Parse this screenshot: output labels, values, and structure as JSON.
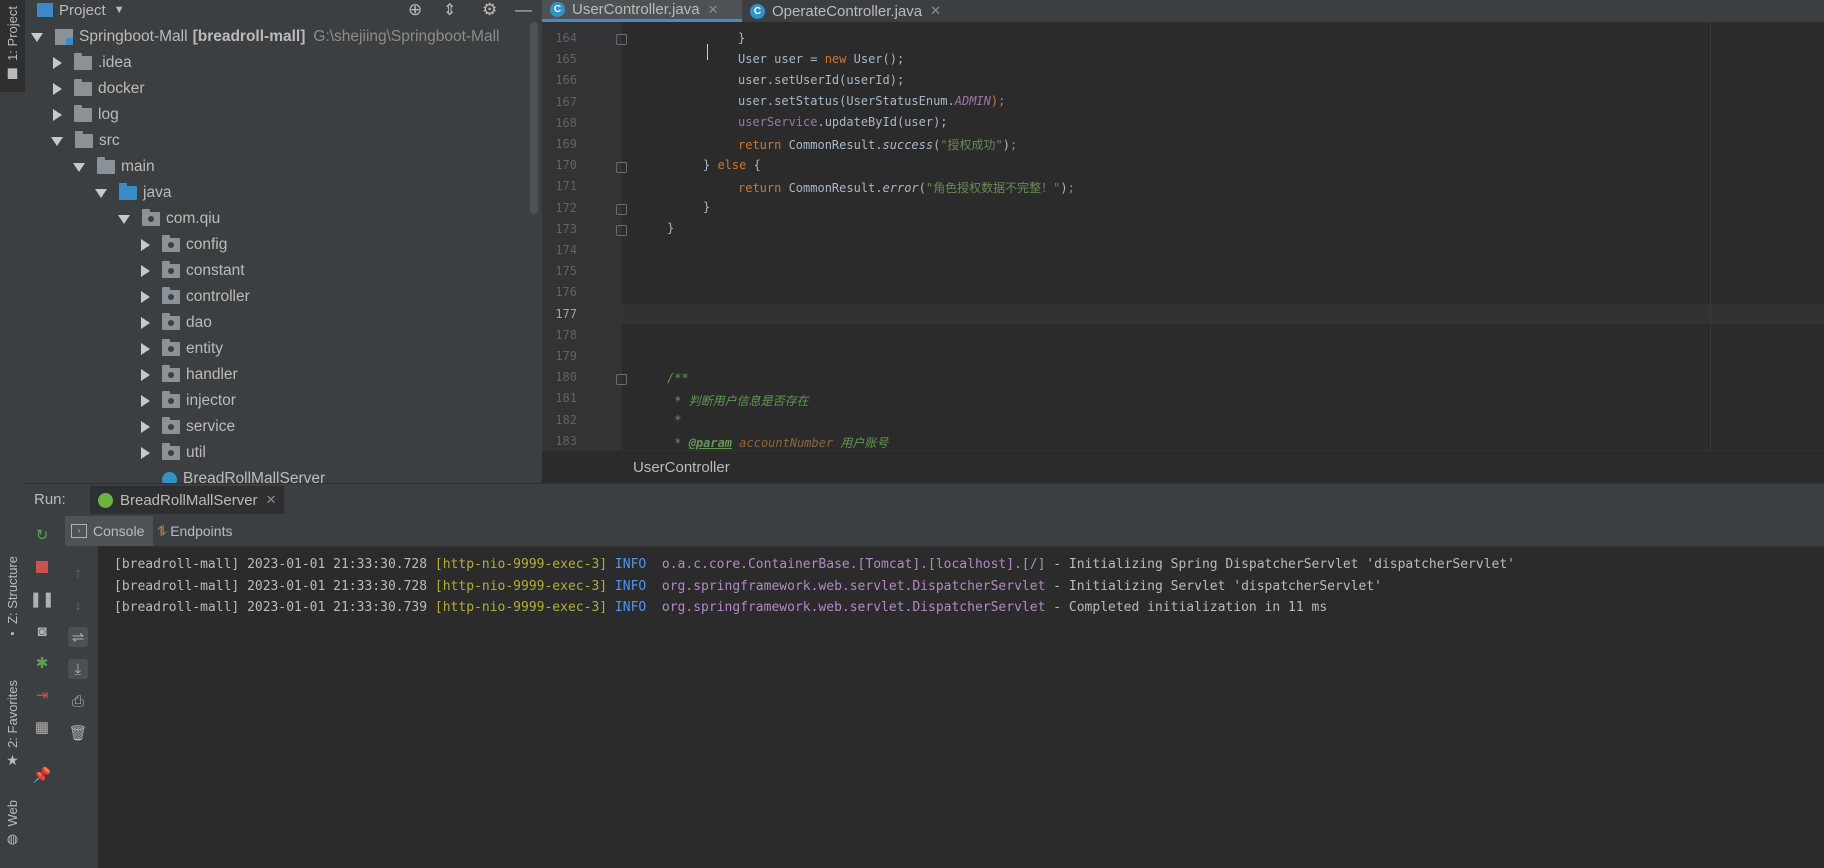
{
  "sidebar_left": {
    "project_tab": "1: Project",
    "structure_tab": "Z: Structure",
    "favorites_tab": "2: Favorites",
    "web_tab": "Web"
  },
  "project_panel": {
    "title": "Project",
    "tree": [
      {
        "label": "Springboot-Mall",
        "bold_part": "[breadroll-mall]",
        "path": "G:\\shejiing\\Springboot-Mall",
        "state": "expanded",
        "kind": "module"
      },
      {
        "label": ".idea",
        "state": "collapsed",
        "kind": "folder"
      },
      {
        "label": "docker",
        "state": "collapsed",
        "kind": "folder"
      },
      {
        "label": "log",
        "state": "collapsed",
        "kind": "folder"
      },
      {
        "label": "src",
        "state": "expanded",
        "kind": "folder"
      },
      {
        "label": "main",
        "state": "expanded",
        "kind": "folder"
      },
      {
        "label": "java",
        "state": "expanded",
        "kind": "source-folder"
      },
      {
        "label": "com.qiu",
        "state": "expanded",
        "kind": "package"
      },
      {
        "label": "config",
        "state": "collapsed",
        "kind": "package"
      },
      {
        "label": "constant",
        "state": "collapsed",
        "kind": "package"
      },
      {
        "label": "controller",
        "state": "collapsed",
        "kind": "package"
      },
      {
        "label": "dao",
        "state": "collapsed",
        "kind": "package"
      },
      {
        "label": "entity",
        "state": "collapsed",
        "kind": "package"
      },
      {
        "label": "handler",
        "state": "collapsed",
        "kind": "package"
      },
      {
        "label": "injector",
        "state": "collapsed",
        "kind": "package"
      },
      {
        "label": "service",
        "state": "collapsed",
        "kind": "package"
      },
      {
        "label": "util",
        "state": "collapsed",
        "kind": "package"
      },
      {
        "label": "BreadRollMallServer",
        "state": "none",
        "kind": "class"
      }
    ]
  },
  "editor": {
    "tabs": [
      {
        "label": "UserController.java",
        "active": true
      },
      {
        "label": "OperateController.java",
        "active": false
      }
    ],
    "line_numbers": [
      "164",
      "165",
      "166",
      "167",
      "168",
      "169",
      "170",
      "171",
      "172",
      "173",
      "174",
      "175",
      "176",
      "177",
      "178",
      "179",
      "180",
      "181",
      "182",
      "183"
    ],
    "current_line": "177",
    "code": {
      "l164": "}",
      "l165_a": "User user = ",
      "l165_kw": "new",
      "l165_b": " User();",
      "l166": "user.setUserId(userId);",
      "l167_a": "user.setStatus(UserStatusEnum.",
      "l167_const": "ADMIN",
      "l167_b": ");",
      "l168_field": "userService",
      "l168_b": ".updateById(user);",
      "l169_kw": "return",
      "l169_a": " CommonResult.",
      "l169_m": "success",
      "l169_str": "\"授权成功\"",
      "l170_a": "} ",
      "l170_kw": "else",
      "l170_b": " {",
      "l171_kw": "return",
      "l171_a": " CommonResult.",
      "l171_m": "error",
      "l171_str": "\"角色授权数据不完整！\"",
      "l172": "}",
      "l173": "}",
      "l180": "/**",
      "l181": " * 判断用户信息是否存在",
      "l182": " *",
      "l183_a": " * ",
      "l183_tag": "@param",
      "l183_param": "accountNumber",
      "l183_b": " 用户账号"
    },
    "breadcrumb": "UserController"
  },
  "run_panel": {
    "label": "Run:",
    "config_name": "BreadRollMallServer",
    "tabs": [
      "Console",
      "Endpoints"
    ],
    "logs": [
      {
        "app": "[breadroll-mall]",
        "time": "2023-01-01 21:33:30.728",
        "thread": "[http-nio-9999-exec-3]",
        "level": "INFO",
        "logger": "o.a.c.core.ContainerBase.[Tomcat].[localhost].[/]",
        "message": "- Initializing Spring DispatcherServlet 'dispatcherServlet'"
      },
      {
        "app": "[breadroll-mall]",
        "time": "2023-01-01 21:33:30.728",
        "thread": "[http-nio-9999-exec-3]",
        "level": "INFO",
        "logger": "org.springframework.web.servlet.DispatcherServlet",
        "message": "- Initializing Servlet 'dispatcherServlet'"
      },
      {
        "app": "[breadroll-mall]",
        "time": "2023-01-01 21:33:30.739",
        "thread": "[http-nio-9999-exec-3]",
        "level": "INFO",
        "logger": "org.springframework.web.servlet.DispatcherServlet",
        "message": "- Completed initialization in 11 ms"
      }
    ]
  },
  "colors": {
    "accent": "#4a88c7",
    "keyword": "#cc7832",
    "string": "#6a8759",
    "thread": "#b1ad38",
    "level": "#5394ec"
  }
}
